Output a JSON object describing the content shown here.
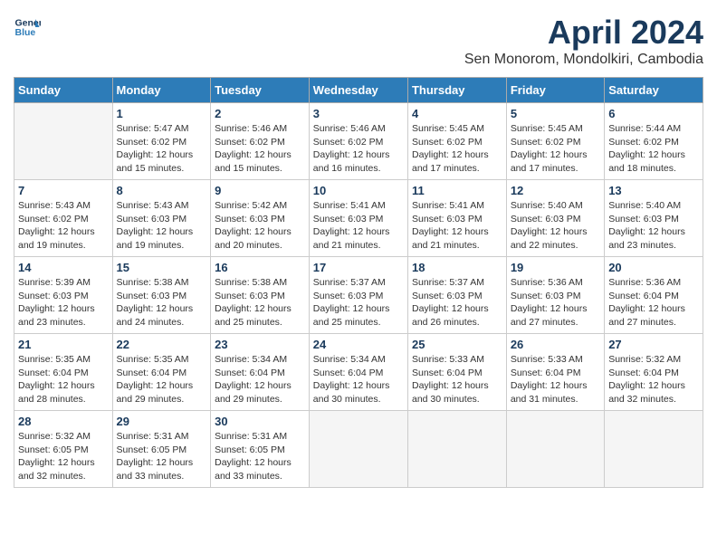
{
  "header": {
    "logo_line1": "General",
    "logo_line2": "Blue",
    "month_title": "April 2024",
    "subtitle": "Sen Monorom, Mondolkiri, Cambodia"
  },
  "days_of_week": [
    "Sunday",
    "Monday",
    "Tuesday",
    "Wednesday",
    "Thursday",
    "Friday",
    "Saturday"
  ],
  "weeks": [
    [
      {
        "day": "",
        "info": ""
      },
      {
        "day": "1",
        "info": "Sunrise: 5:47 AM\nSunset: 6:02 PM\nDaylight: 12 hours\nand 15 minutes."
      },
      {
        "day": "2",
        "info": "Sunrise: 5:46 AM\nSunset: 6:02 PM\nDaylight: 12 hours\nand 15 minutes."
      },
      {
        "day": "3",
        "info": "Sunrise: 5:46 AM\nSunset: 6:02 PM\nDaylight: 12 hours\nand 16 minutes."
      },
      {
        "day": "4",
        "info": "Sunrise: 5:45 AM\nSunset: 6:02 PM\nDaylight: 12 hours\nand 17 minutes."
      },
      {
        "day": "5",
        "info": "Sunrise: 5:45 AM\nSunset: 6:02 PM\nDaylight: 12 hours\nand 17 minutes."
      },
      {
        "day": "6",
        "info": "Sunrise: 5:44 AM\nSunset: 6:02 PM\nDaylight: 12 hours\nand 18 minutes."
      }
    ],
    [
      {
        "day": "7",
        "info": "Sunrise: 5:43 AM\nSunset: 6:02 PM\nDaylight: 12 hours\nand 19 minutes."
      },
      {
        "day": "8",
        "info": "Sunrise: 5:43 AM\nSunset: 6:03 PM\nDaylight: 12 hours\nand 19 minutes."
      },
      {
        "day": "9",
        "info": "Sunrise: 5:42 AM\nSunset: 6:03 PM\nDaylight: 12 hours\nand 20 minutes."
      },
      {
        "day": "10",
        "info": "Sunrise: 5:41 AM\nSunset: 6:03 PM\nDaylight: 12 hours\nand 21 minutes."
      },
      {
        "day": "11",
        "info": "Sunrise: 5:41 AM\nSunset: 6:03 PM\nDaylight: 12 hours\nand 21 minutes."
      },
      {
        "day": "12",
        "info": "Sunrise: 5:40 AM\nSunset: 6:03 PM\nDaylight: 12 hours\nand 22 minutes."
      },
      {
        "day": "13",
        "info": "Sunrise: 5:40 AM\nSunset: 6:03 PM\nDaylight: 12 hours\nand 23 minutes."
      }
    ],
    [
      {
        "day": "14",
        "info": "Sunrise: 5:39 AM\nSunset: 6:03 PM\nDaylight: 12 hours\nand 23 minutes."
      },
      {
        "day": "15",
        "info": "Sunrise: 5:38 AM\nSunset: 6:03 PM\nDaylight: 12 hours\nand 24 minutes."
      },
      {
        "day": "16",
        "info": "Sunrise: 5:38 AM\nSunset: 6:03 PM\nDaylight: 12 hours\nand 25 minutes."
      },
      {
        "day": "17",
        "info": "Sunrise: 5:37 AM\nSunset: 6:03 PM\nDaylight: 12 hours\nand 25 minutes."
      },
      {
        "day": "18",
        "info": "Sunrise: 5:37 AM\nSunset: 6:03 PM\nDaylight: 12 hours\nand 26 minutes."
      },
      {
        "day": "19",
        "info": "Sunrise: 5:36 AM\nSunset: 6:03 PM\nDaylight: 12 hours\nand 27 minutes."
      },
      {
        "day": "20",
        "info": "Sunrise: 5:36 AM\nSunset: 6:04 PM\nDaylight: 12 hours\nand 27 minutes."
      }
    ],
    [
      {
        "day": "21",
        "info": "Sunrise: 5:35 AM\nSunset: 6:04 PM\nDaylight: 12 hours\nand 28 minutes."
      },
      {
        "day": "22",
        "info": "Sunrise: 5:35 AM\nSunset: 6:04 PM\nDaylight: 12 hours\nand 29 minutes."
      },
      {
        "day": "23",
        "info": "Sunrise: 5:34 AM\nSunset: 6:04 PM\nDaylight: 12 hours\nand 29 minutes."
      },
      {
        "day": "24",
        "info": "Sunrise: 5:34 AM\nSunset: 6:04 PM\nDaylight: 12 hours\nand 30 minutes."
      },
      {
        "day": "25",
        "info": "Sunrise: 5:33 AM\nSunset: 6:04 PM\nDaylight: 12 hours\nand 30 minutes."
      },
      {
        "day": "26",
        "info": "Sunrise: 5:33 AM\nSunset: 6:04 PM\nDaylight: 12 hours\nand 31 minutes."
      },
      {
        "day": "27",
        "info": "Sunrise: 5:32 AM\nSunset: 6:04 PM\nDaylight: 12 hours\nand 32 minutes."
      }
    ],
    [
      {
        "day": "28",
        "info": "Sunrise: 5:32 AM\nSunset: 6:05 PM\nDaylight: 12 hours\nand 32 minutes."
      },
      {
        "day": "29",
        "info": "Sunrise: 5:31 AM\nSunset: 6:05 PM\nDaylight: 12 hours\nand 33 minutes."
      },
      {
        "day": "30",
        "info": "Sunrise: 5:31 AM\nSunset: 6:05 PM\nDaylight: 12 hours\nand 33 minutes."
      },
      {
        "day": "",
        "info": ""
      },
      {
        "day": "",
        "info": ""
      },
      {
        "day": "",
        "info": ""
      },
      {
        "day": "",
        "info": ""
      }
    ]
  ]
}
